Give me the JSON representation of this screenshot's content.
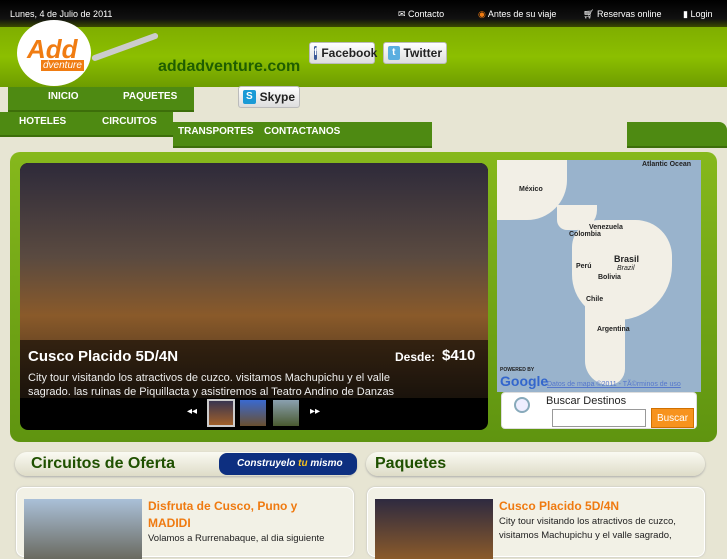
{
  "topbar": {
    "date": "Lunes, 4 de Julio de 2011",
    "links": [
      "Contacto",
      "Antes de su viaje",
      "Reservas online",
      "Login"
    ]
  },
  "header": {
    "site_name": "addadventure.com",
    "logo_text": "Add",
    "logo_sub": "dventure",
    "social": {
      "facebook": "Facebook",
      "twitter": "Twitter",
      "skype": "Skype"
    }
  },
  "nav": {
    "row1": [
      "INICIO",
      "PAQUETES"
    ],
    "row2": [
      "HOTELES",
      "CIRCUITOS"
    ],
    "row3": [
      "TRANSPORTES",
      "CONTACTANOS"
    ]
  },
  "slideshow": {
    "title": "Cusco Placido 5D/4N",
    "price_label": "Desde:",
    "price": "$410",
    "description": "City tour visitando los atractivos de cuzco. visitamos Machupichu y el valle sagrado. las ruinas de Piquillacta y asistiremos al Teatro Andino de Danzas",
    "prev": "◂◂",
    "next": "▸▸",
    "active_thumb": 0
  },
  "map": {
    "labels": [
      "Atlantic Ocean",
      "México",
      "Venezuela",
      "Colombia",
      "Brasil",
      "Brazil",
      "Perú",
      "Bolivia",
      "Chile",
      "Argentina"
    ],
    "powered": "POWERED BY",
    "google": "Google",
    "terms": "Datos de mapa ©2011 - TÃ©rminos de uso"
  },
  "search": {
    "label": "Buscar Destinos",
    "value": "",
    "button": "Buscar"
  },
  "sections": {
    "circuitos": "Circuitos de Oferta",
    "construyelo": "Construyelo",
    "tu": "tu",
    "mismo": "mismo",
    "paquetes": "Paquetes"
  },
  "cards": [
    {
      "title": "Disfruta de Cusco, Puno y MADIDI",
      "desc": "Volamos a Rurrenabaque, al dia siguiente"
    },
    {
      "title": "Cusco Placido 5D/4N",
      "desc": "City tour visitando los atractivos de cuzco, visitamos Machupichu y el valle sagrado,"
    }
  ]
}
